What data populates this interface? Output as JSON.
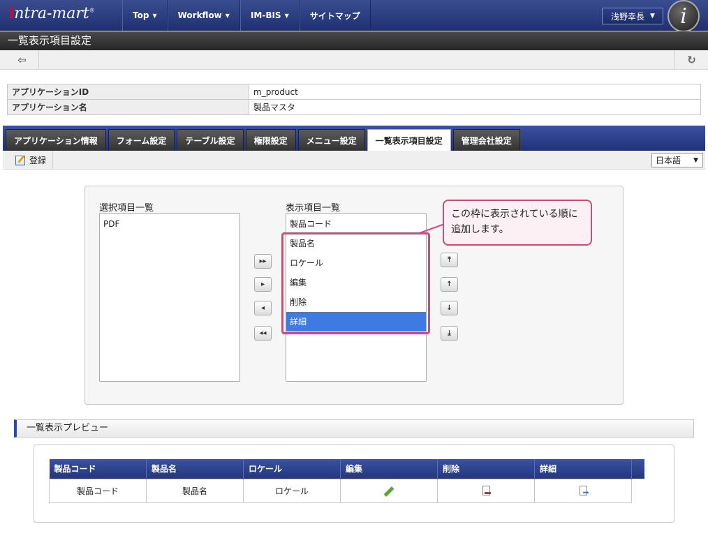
{
  "header": {
    "logo": "intra-mart",
    "nav": [
      {
        "label": "Top",
        "dropdown": true
      },
      {
        "label": "Workflow",
        "dropdown": true
      },
      {
        "label": "IM-BIS",
        "dropdown": true
      },
      {
        "label": "サイトマップ",
        "dropdown": false
      }
    ],
    "user": "浅野幸長",
    "icon": "intra-mart-i-icon"
  },
  "page_title": "一覧表示項目設定",
  "toolbar": {
    "back_icon": "back-arrow-icon",
    "reload_icon": "reload-icon"
  },
  "info": {
    "rows": [
      {
        "key": "アプリケーションID",
        "value": "m_product"
      },
      {
        "key": "アプリケーション名",
        "value": "製品マスタ"
      }
    ]
  },
  "tabs": [
    {
      "label": "アプリケーション情報",
      "active": false
    },
    {
      "label": "フォーム設定",
      "active": false
    },
    {
      "label": "テーブル設定",
      "active": false
    },
    {
      "label": "権限設定",
      "active": false
    },
    {
      "label": "メニュー設定",
      "active": false
    },
    {
      "label": "一覧表示項目設定",
      "active": true
    },
    {
      "label": "管理会社設定",
      "active": false
    }
  ],
  "action_bar": {
    "register_label": "登録",
    "language": "日本語"
  },
  "selection": {
    "available_label": "選択項目一覧",
    "available_items": [
      "PDF"
    ],
    "displayed_label": "表示項目一覧",
    "displayed_items": [
      "製品コード",
      "製品名",
      "ロケール",
      "編集",
      "削除",
      "詳細"
    ],
    "selected_item": "詳細",
    "move_buttons": [
      "▸▸",
      "▸",
      "◂",
      "◂◂"
    ],
    "order_buttons": [
      "⤒",
      "↑",
      "↓",
      "⤓"
    ]
  },
  "callout": {
    "text": "この枠に表示されている順に追加します。",
    "color": "#d9447d"
  },
  "preview": {
    "title": "一覧表示プレビュー",
    "columns": [
      "製品コード",
      "製品名",
      "ロケール",
      "編集",
      "削除",
      "詳細"
    ],
    "row": [
      "製品コード",
      "製品名",
      "ロケール"
    ],
    "row_icons": [
      "pencil-icon",
      "delete-doc-icon",
      "detail-doc-icon"
    ]
  },
  "colors": {
    "brand": "#1f3379",
    "accent": "#d9447d",
    "selected": "#3d7be0"
  }
}
